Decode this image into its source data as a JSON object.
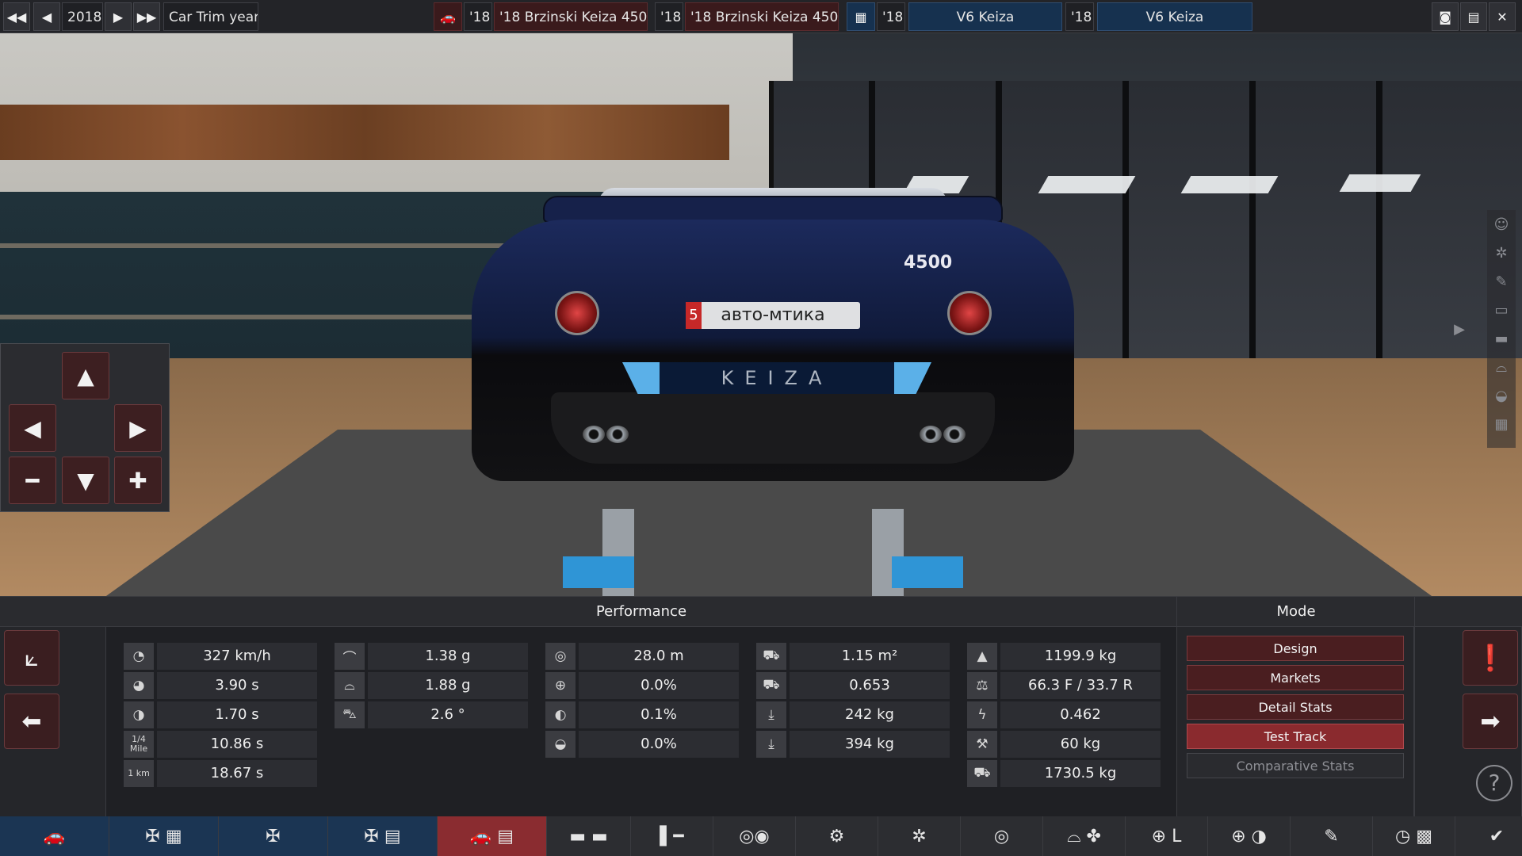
{
  "topbar": {
    "year": "2018",
    "trim_label": "Car Trim year",
    "model_year_1": "'18",
    "model_name_1": "'18 Brzinski Keiza 4500 '",
    "model_year_2": "'18",
    "model_name_2": "'18 Brzinski Keiza 4500 '",
    "engine_year_1": "'18",
    "engine_name_1": "V6 Keiza",
    "engine_year_2": "'18",
    "engine_name_2": "V6 Keiza"
  },
  "car": {
    "plate_number": "5",
    "plate_text": "авто-мтика",
    "badge": "4500",
    "brand_text": "KEIZA"
  },
  "panel": {
    "performance_title": "Performance",
    "mode_title": "Mode",
    "stats_col1": [
      "327 km/h",
      "3.90 s",
      "1.70 s",
      "10.86 s",
      "18.67 s"
    ],
    "stats_col1_labels": [
      "",
      "",
      "",
      "1/4 Mile",
      "1 km"
    ],
    "stats_col2": [
      "1.38 g",
      "1.88 g",
      "2.6 °"
    ],
    "stats_col3": [
      "28.0 m",
      "0.0%",
      "0.1%",
      "0.0%"
    ],
    "stats_col4": [
      "1.15 m²",
      "0.653",
      "242 kg",
      "394 kg"
    ],
    "stats_col5": [
      "1199.9 kg",
      "66.3 F / 33.7 R",
      "0.462",
      "60 kg",
      "1730.5 kg"
    ],
    "mode_buttons": [
      "Design",
      "Markets",
      "Detail Stats",
      "Test Track",
      "Comparative Stats"
    ],
    "help": "?"
  },
  "colors": {
    "accent_red": "#8a2a2e",
    "nav_blue": "#1b3553"
  }
}
